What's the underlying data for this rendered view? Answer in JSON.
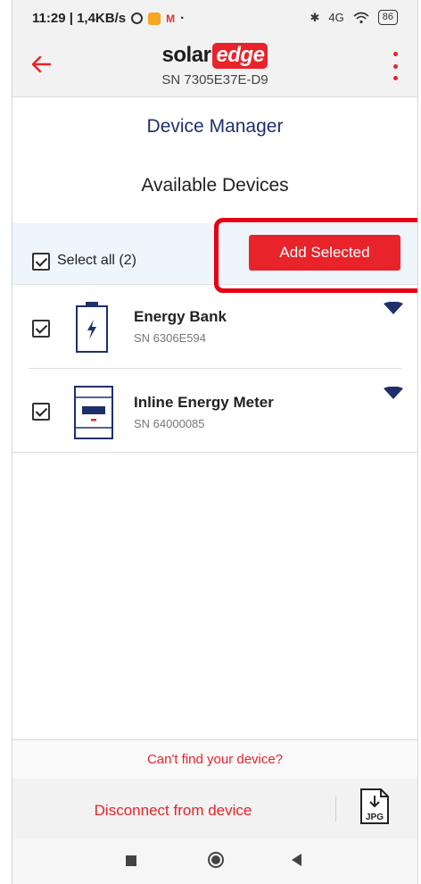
{
  "status_bar": {
    "time_speed": "11:29 | 1,4KB/s",
    "network": "4G",
    "battery": "86"
  },
  "header": {
    "logo_part1": "solar",
    "logo_part2": "edge",
    "serial": "SN 7305E37E-D9"
  },
  "page": {
    "title": "Device Manager",
    "subtitle": "Available Devices"
  },
  "selection": {
    "select_all_label": "Select all (2)",
    "add_button": "Add Selected"
  },
  "devices": [
    {
      "name": "Energy Bank",
      "sn": "SN 6306E594",
      "icon": "battery-icon"
    },
    {
      "name": "Inline Energy Meter",
      "sn": "SN 64000085",
      "icon": "meter-icon"
    }
  ],
  "bottom": {
    "cant_find": "Can't find your device?",
    "disconnect": "Disconnect from device",
    "export_label": "JPG"
  },
  "colors": {
    "accent": "#e8232a",
    "title": "#1f2f6b",
    "band": "#eef5fb",
    "highlight": "#e60012"
  }
}
